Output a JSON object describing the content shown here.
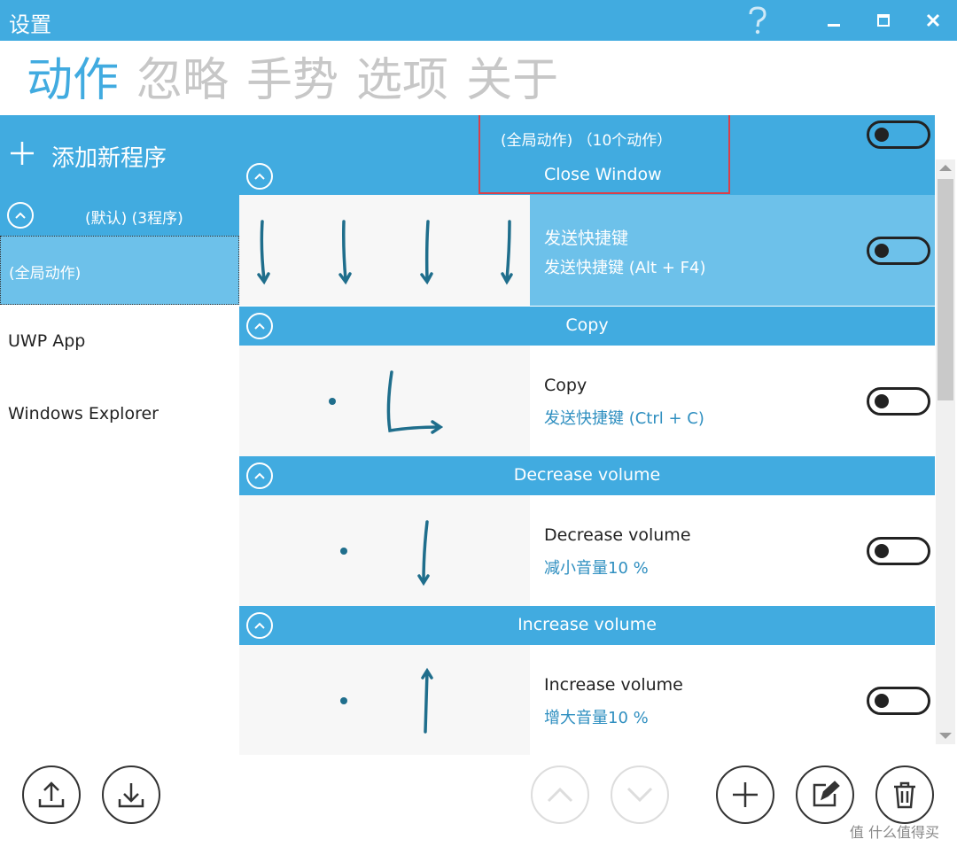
{
  "window": {
    "title": "设置"
  },
  "nav": {
    "tabs": [
      {
        "label": "动作",
        "active": true
      },
      {
        "label": "忽略",
        "active": false
      },
      {
        "label": "手势",
        "active": false
      },
      {
        "label": "选项",
        "active": false
      },
      {
        "label": "关于",
        "active": false
      }
    ]
  },
  "left": {
    "add_program": "添加新程序",
    "group_label": "(默认) (3程序)",
    "programs": [
      "(全局动作)",
      "UWP App",
      "Windows Explorer"
    ]
  },
  "right": {
    "header_count": "(全局动作) （10个动作）",
    "first_title": "Close Window",
    "actions": [
      {
        "header": "Close Window",
        "name": "发送快捷键",
        "desc": "发送快捷键 (Alt + F4)",
        "selected": true
      },
      {
        "header": "Copy",
        "name": "Copy",
        "desc": "发送快捷键 (Ctrl + C)",
        "selected": false
      },
      {
        "header": "Decrease volume",
        "name": "Decrease volume",
        "desc": "减小音量10 %",
        "selected": false
      },
      {
        "header": "Increase volume",
        "name": "Increase volume",
        "desc": "增大音量10 %",
        "selected": false
      }
    ]
  },
  "watermark": "值 什么值得买",
  "colors": {
    "accent": "#41abe0",
    "selected": "#6dc1ea",
    "link": "#2f8fc0",
    "highlight_box": "#d9404a"
  }
}
